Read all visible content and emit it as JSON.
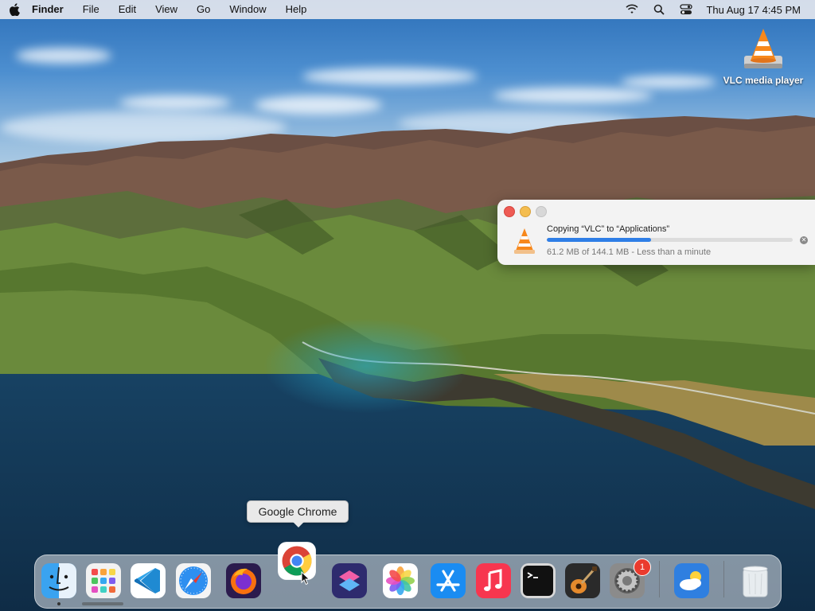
{
  "menubar": {
    "app_name": "Finder",
    "menus": [
      "File",
      "Edit",
      "View",
      "Go",
      "Window",
      "Help"
    ],
    "clock": "Thu Aug 17  4:45 PM",
    "status_icons": [
      "wifi-icon",
      "spotlight-search-icon",
      "control-center-icon"
    ]
  },
  "desktop": {
    "icons": [
      {
        "label": "VLC media player",
        "icon": "vlc-cone-icon"
      }
    ]
  },
  "copy_dialog": {
    "title": "Copying “VLC” to “Applications”",
    "status": "61.2 MB of 144.1 MB - Less than a minute",
    "progress_fraction": 0.425,
    "progress_color": "#2f7ee6"
  },
  "tooltip": {
    "text": "Google Chrome"
  },
  "dock": {
    "apps": [
      {
        "name": "Finder",
        "icon": "finder-icon",
        "running": true
      },
      {
        "name": "Launchpad",
        "icon": "launchpad-icon"
      },
      {
        "name": "Visual Studio Code",
        "icon": "vscode-icon"
      },
      {
        "name": "Safari",
        "icon": "safari-icon"
      },
      {
        "name": "Firefox",
        "icon": "firefox-icon"
      },
      {
        "name": "Google Chrome",
        "icon": "chrome-icon"
      },
      {
        "name": "Shortcuts",
        "icon": "shortcuts-icon"
      },
      {
        "name": "Photos",
        "icon": "photos-icon"
      },
      {
        "name": "App Store",
        "icon": "app-store-icon"
      },
      {
        "name": "Music",
        "icon": "music-icon"
      },
      {
        "name": "Terminal",
        "icon": "terminal-icon"
      },
      {
        "name": "GarageBand",
        "icon": "garageband-icon"
      },
      {
        "name": "System Preferences",
        "icon": "system-preferences-icon",
        "badge": "1"
      },
      {
        "name": "Weather",
        "icon": "weather-icon"
      },
      {
        "name": "Trash",
        "icon": "trash-icon"
      }
    ]
  }
}
